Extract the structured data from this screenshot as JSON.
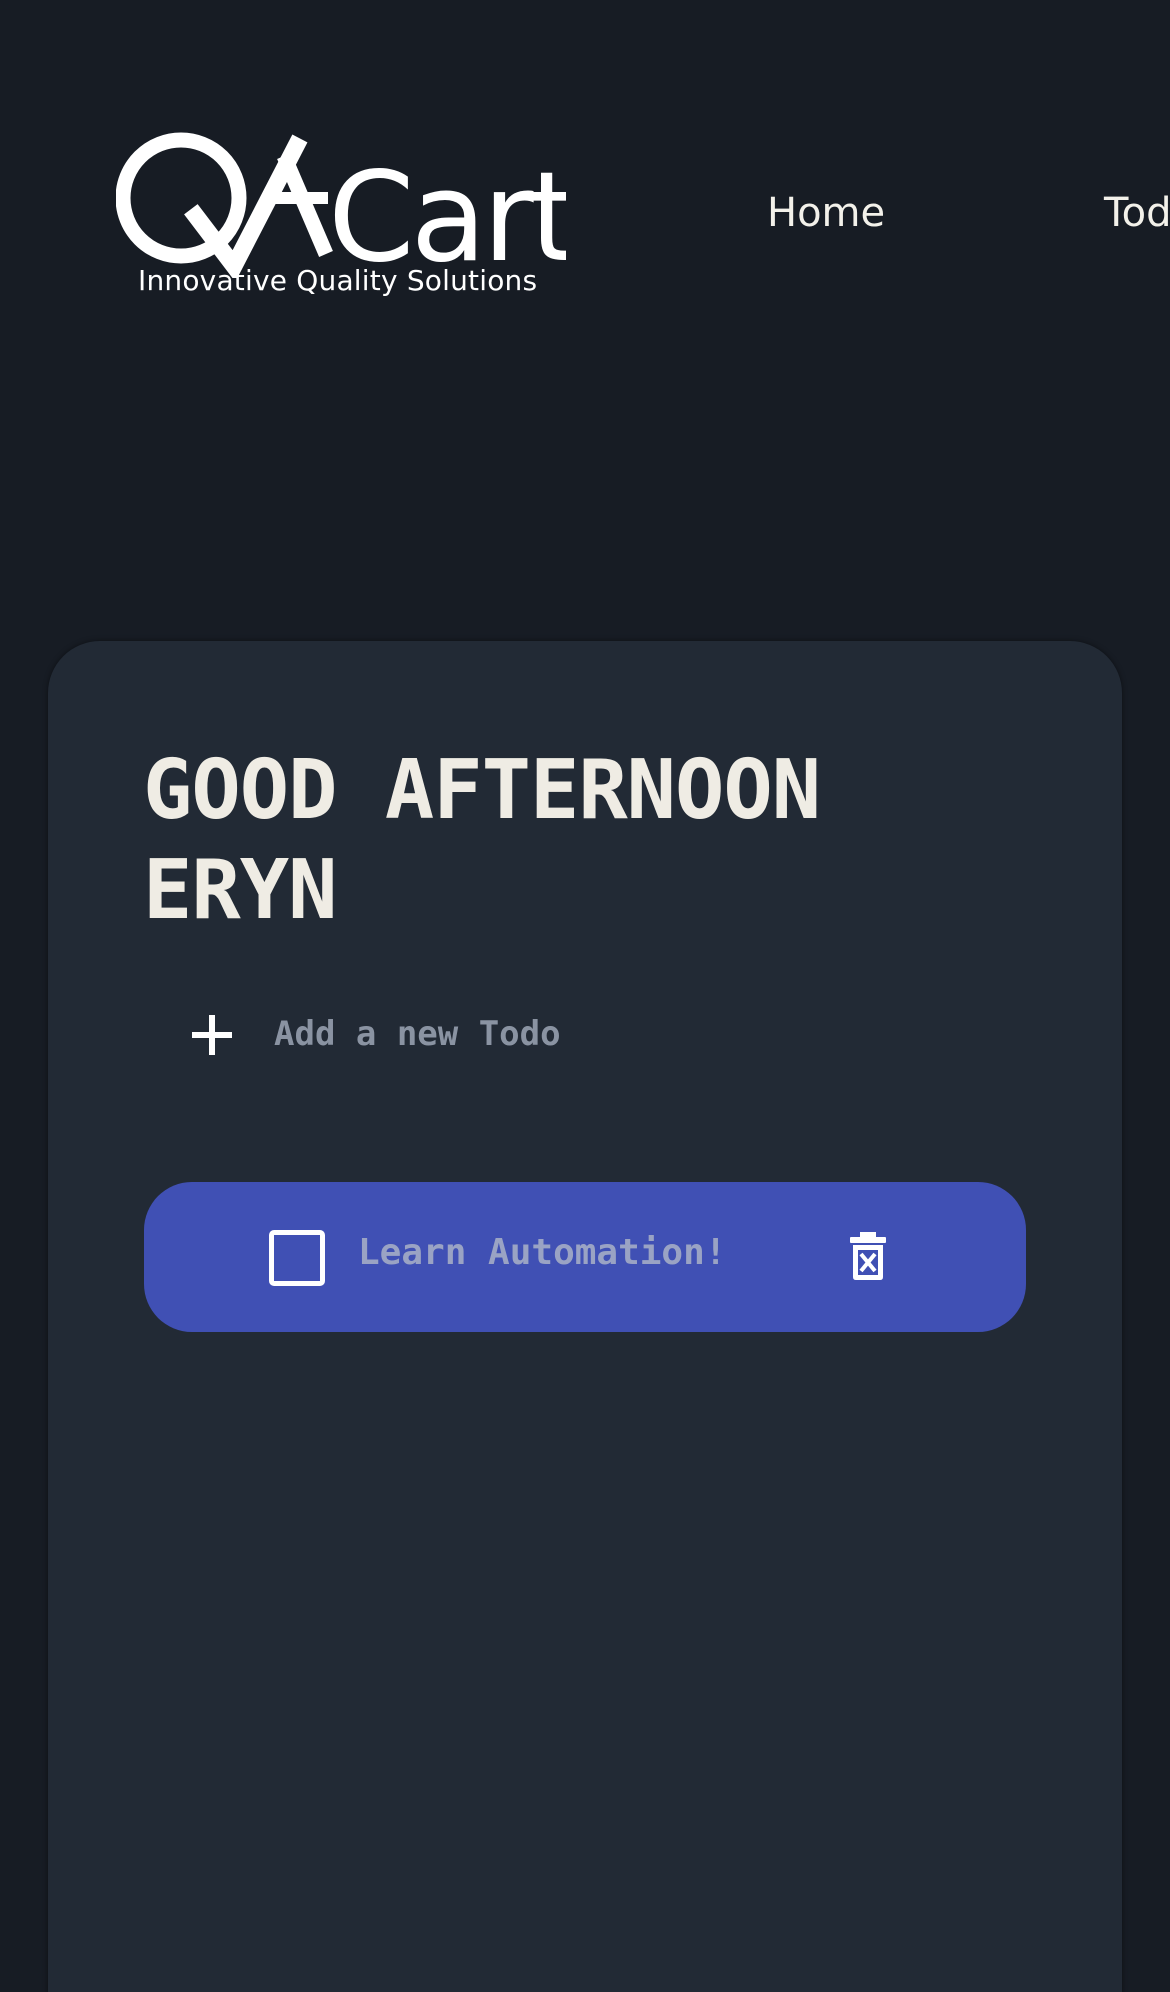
{
  "brand": {
    "logo_text": "QACart",
    "tagline": "Innovative Quality Solutions"
  },
  "nav": {
    "home": "Home",
    "todo": "Todo"
  },
  "main": {
    "greeting": "GOOD AFTERNOON ERYN",
    "new_todo_placeholder": "Add a new Todo"
  },
  "todos": [
    {
      "text": "Learn Automation!",
      "completed": false
    }
  ],
  "colors": {
    "background": "#171c24",
    "card": "#222a35",
    "todo_item": "#4050b4",
    "text": "#efece4"
  },
  "icons": {
    "add": "plus-icon",
    "delete": "trash-icon"
  }
}
